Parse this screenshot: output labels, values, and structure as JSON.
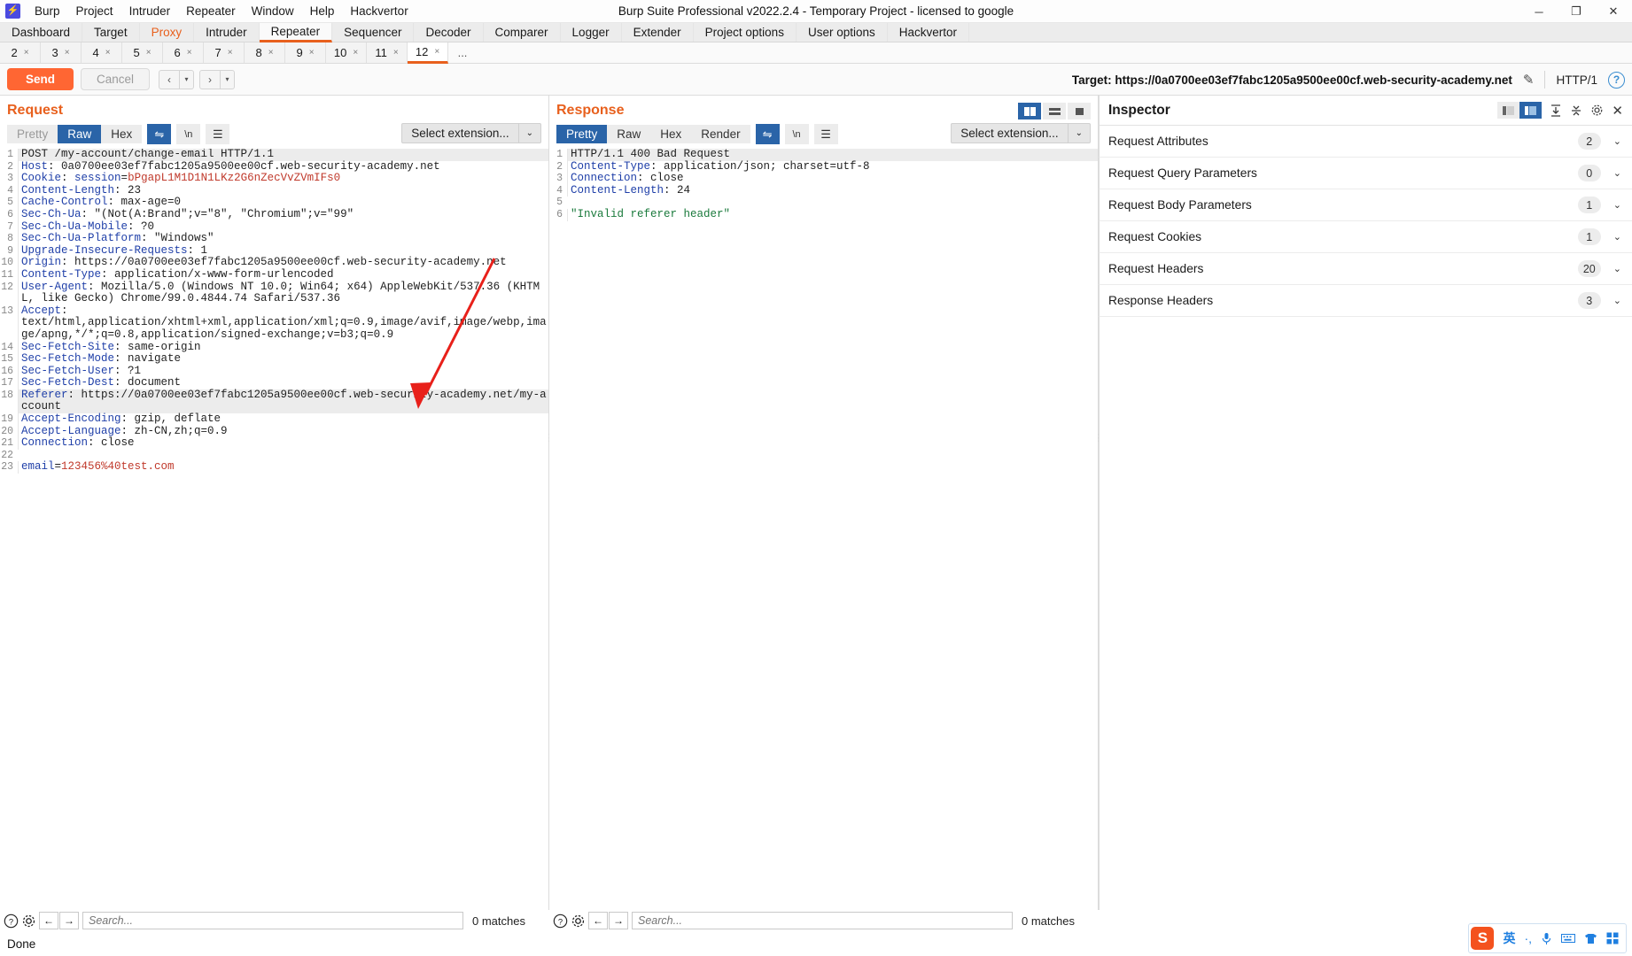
{
  "window": {
    "title": "Burp Suite Professional v2022.2.4 - Temporary Project - licensed to google",
    "logo_glyph": "⚡",
    "minimize": "─",
    "maximize": "❐",
    "close": "✕"
  },
  "menubar": [
    "Burp",
    "Project",
    "Intruder",
    "Repeater",
    "Window",
    "Help",
    "Hackvertor"
  ],
  "main_tabs": [
    {
      "label": "Dashboard",
      "state": "normal"
    },
    {
      "label": "Target",
      "state": "normal"
    },
    {
      "label": "Proxy",
      "state": "proxy"
    },
    {
      "label": "Intruder",
      "state": "normal"
    },
    {
      "label": "Repeater",
      "state": "active"
    },
    {
      "label": "Sequencer",
      "state": "normal"
    },
    {
      "label": "Decoder",
      "state": "normal"
    },
    {
      "label": "Comparer",
      "state": "normal"
    },
    {
      "label": "Logger",
      "state": "normal"
    },
    {
      "label": "Extender",
      "state": "normal"
    },
    {
      "label": "Project options",
      "state": "normal"
    },
    {
      "label": "User options",
      "state": "normal"
    },
    {
      "label": "Hackvertor",
      "state": "normal"
    }
  ],
  "repeater_tabs": [
    {
      "label": "2",
      "close": "×",
      "active": false
    },
    {
      "label": "3",
      "close": "×",
      "active": false
    },
    {
      "label": "4",
      "close": "×",
      "active": false
    },
    {
      "label": "5",
      "close": "×",
      "active": false
    },
    {
      "label": "6",
      "close": "×",
      "active": false
    },
    {
      "label": "7",
      "close": "×",
      "active": false
    },
    {
      "label": "8",
      "close": "×",
      "active": false
    },
    {
      "label": "9",
      "close": "×",
      "active": false
    },
    {
      "label": "10",
      "close": "×",
      "active": false
    },
    {
      "label": "11",
      "close": "×",
      "active": false
    },
    {
      "label": "12",
      "close": "×",
      "active": true
    }
  ],
  "repeater_tabs_more": "...",
  "actionbar": {
    "send_label": "Send",
    "cancel_label": "Cancel",
    "back_arrow": "‹",
    "forward_arrow": "›",
    "caret": "▾",
    "target_label": "Target: https://0a0700ee03ef7fabc1205a9500ee00cf.web-security-academy.net",
    "pencil_icon": "✎",
    "http_version": "HTTP/1",
    "help_glyph": "?"
  },
  "request": {
    "title": "Request",
    "tabs": [
      {
        "label": "Pretty",
        "state": "dim"
      },
      {
        "label": "Raw",
        "state": "active"
      },
      {
        "label": "Hex",
        "state": "normal"
      }
    ],
    "tools": [
      {
        "glyph": "⇋",
        "name": "wrap-lines-icon",
        "on": true
      },
      {
        "glyph": "\\n",
        "name": "newline-icon",
        "on": false
      },
      {
        "glyph": "☰",
        "name": "menu-icon",
        "on": false
      }
    ],
    "select_extension": "Select extension...",
    "select_caret": "⌄",
    "lines": [
      {
        "n": "1",
        "hl": true,
        "parts": [
          {
            "t": "POST /my-account/change-email HTTP/1.1",
            "c": "val"
          }
        ]
      },
      {
        "n": "2",
        "parts": [
          {
            "t": "Host",
            "c": "hdr"
          },
          {
            "t": ": 0a0700ee03ef7fabc1205a9500ee00cf.web-security-academy.net",
            "c": "val"
          }
        ]
      },
      {
        "n": "3",
        "parts": [
          {
            "t": "Cookie",
            "c": "hdr"
          },
          {
            "t": ": ",
            "c": "val"
          },
          {
            "t": "session",
            "c": "hdr"
          },
          {
            "t": "=",
            "c": "val"
          },
          {
            "t": "bPgapL1M1D1N1LKz2G6nZecVvZVmIFs0",
            "c": "red"
          }
        ]
      },
      {
        "n": "4",
        "parts": [
          {
            "t": "Content-Length",
            "c": "hdr"
          },
          {
            "t": ": 23",
            "c": "val"
          }
        ]
      },
      {
        "n": "5",
        "parts": [
          {
            "t": "Cache-Control",
            "c": "hdr"
          },
          {
            "t": ": max-age=0",
            "c": "val"
          }
        ]
      },
      {
        "n": "6",
        "parts": [
          {
            "t": "Sec-Ch-Ua",
            "c": "hdr"
          },
          {
            "t": ": \"(Not(A:Brand\";v=\"8\", \"Chromium\";v=\"99\"",
            "c": "val"
          }
        ]
      },
      {
        "n": "7",
        "parts": [
          {
            "t": "Sec-Ch-Ua-Mobile",
            "c": "hdr"
          },
          {
            "t": ": ?0",
            "c": "val"
          }
        ]
      },
      {
        "n": "8",
        "parts": [
          {
            "t": "Sec-Ch-Ua-Platform",
            "c": "hdr"
          },
          {
            "t": ": \"Windows\"",
            "c": "val"
          }
        ]
      },
      {
        "n": "9",
        "parts": [
          {
            "t": "Upgrade-Insecure-Requests",
            "c": "hdr"
          },
          {
            "t": ": 1",
            "c": "val"
          }
        ]
      },
      {
        "n": "10",
        "parts": [
          {
            "t": "Origin",
            "c": "hdr"
          },
          {
            "t": ": https://0a0700ee03ef7fabc1205a9500ee00cf.web-security-academy.net",
            "c": "val"
          }
        ]
      },
      {
        "n": "11",
        "parts": [
          {
            "t": "Content-Type",
            "c": "hdr"
          },
          {
            "t": ": application/x-www-form-urlencoded",
            "c": "val"
          }
        ]
      },
      {
        "n": "12",
        "parts": [
          {
            "t": "User-Agent",
            "c": "hdr"
          },
          {
            "t": ": Mozilla/5.0 (Windows NT 10.0; Win64; x64) AppleWebKit/537.36 (KHTML, like Gecko) Chrome/99.0.4844.74 Safari/537.36",
            "c": "val"
          }
        ]
      },
      {
        "n": "13",
        "parts": [
          {
            "t": "Accept",
            "c": "hdr"
          },
          {
            "t": ": \ntext/html,application/xhtml+xml,application/xml;q=0.9,image/avif,image/webp,image/apng,*/*;q=0.8,application/signed-exchange;v=b3;q=0.9",
            "c": "val"
          }
        ]
      },
      {
        "n": "14",
        "parts": [
          {
            "t": "Sec-Fetch-Site",
            "c": "hdr"
          },
          {
            "t": ": same-origin",
            "c": "val"
          }
        ]
      },
      {
        "n": "15",
        "parts": [
          {
            "t": "Sec-Fetch-Mode",
            "c": "hdr"
          },
          {
            "t": ": navigate",
            "c": "val"
          }
        ]
      },
      {
        "n": "16",
        "parts": [
          {
            "t": "Sec-Fetch-User",
            "c": "hdr"
          },
          {
            "t": ": ?1",
            "c": "val"
          }
        ]
      },
      {
        "n": "17",
        "parts": [
          {
            "t": "Sec-Fetch-Dest",
            "c": "hdr"
          },
          {
            "t": ": document",
            "c": "val"
          }
        ]
      },
      {
        "n": "18",
        "hl": true,
        "parts": [
          {
            "t": "Referer",
            "c": "hdr"
          },
          {
            "t": ": https://0a0700ee03ef7fabc1205a9500ee00cf.web-security-academy.net/my-account",
            "c": "val"
          }
        ]
      },
      {
        "n": "19",
        "parts": [
          {
            "t": "Accept-Encoding",
            "c": "hdr"
          },
          {
            "t": ": gzip, deflate",
            "c": "val"
          }
        ]
      },
      {
        "n": "20",
        "parts": [
          {
            "t": "Accept-Language",
            "c": "hdr"
          },
          {
            "t": ": zh-CN,zh;q=0.9",
            "c": "val"
          }
        ]
      },
      {
        "n": "21",
        "parts": [
          {
            "t": "Connection",
            "c": "hdr"
          },
          {
            "t": ": close",
            "c": "val"
          }
        ]
      },
      {
        "n": "22",
        "parts": [
          {
            "t": "",
            "c": "val"
          }
        ]
      },
      {
        "n": "23",
        "parts": [
          {
            "t": "email",
            "c": "blue"
          },
          {
            "t": "=",
            "c": "val"
          },
          {
            "t": "123456%40test.com",
            "c": "red"
          }
        ]
      }
    ],
    "search_placeholder": "Search...",
    "matches": "0 matches",
    "help_glyph": "?",
    "gear_glyph": "⚙",
    "prev_glyph": "←",
    "next_glyph": "→"
  },
  "response": {
    "title": "Response",
    "tabs": [
      {
        "label": "Pretty",
        "state": "active"
      },
      {
        "label": "Raw",
        "state": "normal"
      },
      {
        "label": "Hex",
        "state": "normal"
      },
      {
        "label": "Render",
        "state": "normal"
      }
    ],
    "tools": [
      {
        "glyph": "⇋",
        "name": "wrap-lines-icon",
        "on": true
      },
      {
        "glyph": "\\n",
        "name": "newline-icon",
        "on": false
      },
      {
        "glyph": "☰",
        "name": "menu-icon",
        "on": false
      }
    ],
    "select_extension": "Select extension...",
    "select_caret": "⌄",
    "layout_buttons": [
      "split-vertical-icon",
      "split-horizontal-icon",
      "single-pane-icon"
    ],
    "lines": [
      {
        "n": "1",
        "hl": true,
        "parts": [
          {
            "t": "HTTP/1.1 400 Bad Request",
            "c": "val"
          }
        ]
      },
      {
        "n": "2",
        "parts": [
          {
            "t": "Content-Type",
            "c": "hdr"
          },
          {
            "t": ": application/json; charset=utf-8",
            "c": "val"
          }
        ]
      },
      {
        "n": "3",
        "parts": [
          {
            "t": "Connection",
            "c": "hdr"
          },
          {
            "t": ": close",
            "c": "val"
          }
        ]
      },
      {
        "n": "4",
        "parts": [
          {
            "t": "Content-Length",
            "c": "hdr"
          },
          {
            "t": ": 24",
            "c": "val"
          }
        ]
      },
      {
        "n": "5",
        "parts": [
          {
            "t": "",
            "c": "val"
          }
        ]
      },
      {
        "n": "6",
        "parts": [
          {
            "t": "\"Invalid referer header\"",
            "c": "green"
          }
        ]
      }
    ],
    "search_placeholder": "Search...",
    "matches": "0 matches",
    "help_glyph": "?",
    "gear_glyph": "⚙",
    "prev_glyph": "←",
    "next_glyph": "→"
  },
  "inspector": {
    "title": "Inspector",
    "tools": {
      "view_left": "panel-left-icon",
      "view_right": "panel-right-icon",
      "expand_glyph": "⧉",
      "collapse_glyph": "⨍",
      "gear_glyph": "⚙",
      "close_glyph": "✕"
    },
    "rows": [
      {
        "label": "Request Attributes",
        "count": "2",
        "chevron": "⌄"
      },
      {
        "label": "Request Query Parameters",
        "count": "0",
        "chevron": "⌄"
      },
      {
        "label": "Request Body Parameters",
        "count": "1",
        "chevron": "⌄"
      },
      {
        "label": "Request Cookies",
        "count": "1",
        "chevron": "⌄"
      },
      {
        "label": "Request Headers",
        "count": "20",
        "chevron": "⌄"
      },
      {
        "label": "Response Headers",
        "count": "3",
        "chevron": "⌄"
      }
    ]
  },
  "statusbar": {
    "text": "Done"
  },
  "tray": {
    "sogou_glyph": "S",
    "items": [
      "英",
      "·,",
      "🎙",
      "⌨",
      "👕",
      "▦"
    ]
  },
  "colors": {
    "accent_orange": "#e8601d",
    "send_orange": "#ff6633",
    "active_blue": "#2a64a8",
    "header_blue": "#1f3fa8",
    "value_red": "#c0392b",
    "string_green": "#1a7a3c",
    "arrow_red": "#e8201a"
  }
}
